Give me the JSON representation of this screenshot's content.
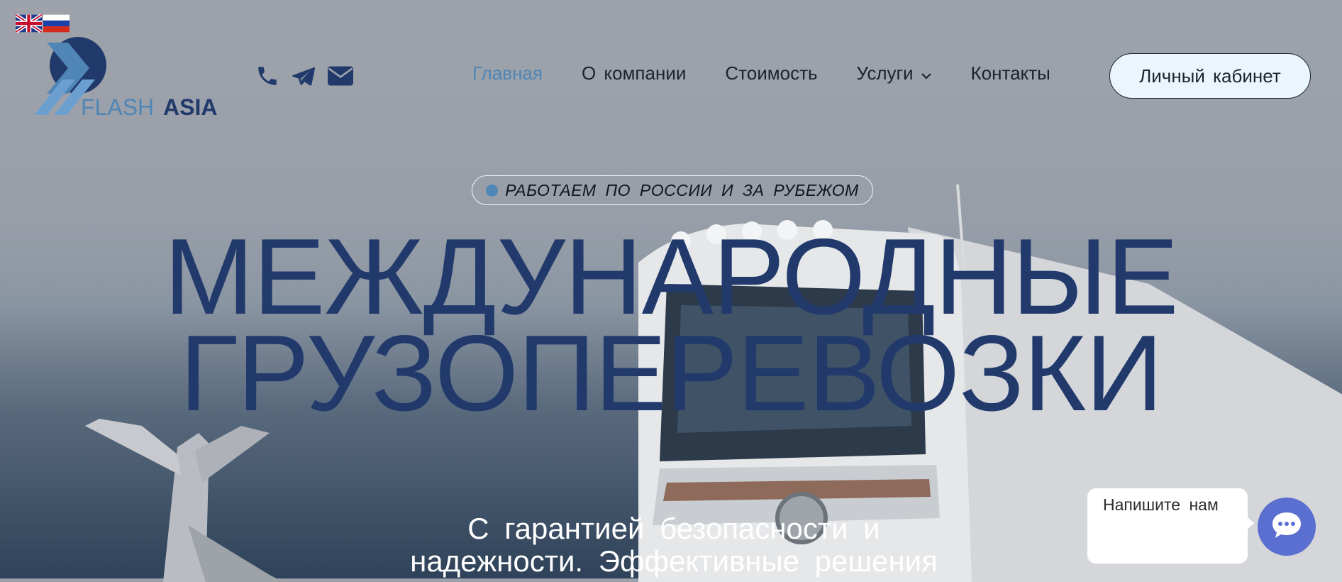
{
  "colors": {
    "accent": "#4f86b6",
    "headline": "#213a6b",
    "nav_text": "#1c2330",
    "cabinet_bg": "#eaf5fc",
    "chat_button": "#5a6fd0"
  },
  "languages": [
    {
      "icon": "uk-flag-icon"
    },
    {
      "icon": "ru-flag-icon"
    }
  ],
  "logo": {
    "text_flash": "FLASH",
    "text_asia": "ASIA"
  },
  "contacts": [
    {
      "icon": "phone-icon"
    },
    {
      "icon": "telegram-icon"
    },
    {
      "icon": "envelope-icon"
    }
  ],
  "nav": {
    "items": [
      {
        "label": "Главная",
        "active": true
      },
      {
        "label": "О компании"
      },
      {
        "label": "Стоимость"
      },
      {
        "label": "Услуги",
        "icon": "chevron-down-icon"
      },
      {
        "label": "Контакты"
      }
    ],
    "cabinet_label": "Личный кабинет"
  },
  "hero": {
    "tagline": "РАБОТАЕМ ПО РОССИИ И ЗА РУБЕЖОМ",
    "title_line1": "МЕЖДУНАРОДНЫЕ",
    "title_line2": "ГРУЗОПЕРЕВОЗКИ",
    "subtitle_line1": "С гарантией безопасности и",
    "subtitle_line2": "надежности. Эффективные решения"
  },
  "chat": {
    "bubble_text": "Напишите нам",
    "icon": "chat-icon"
  }
}
